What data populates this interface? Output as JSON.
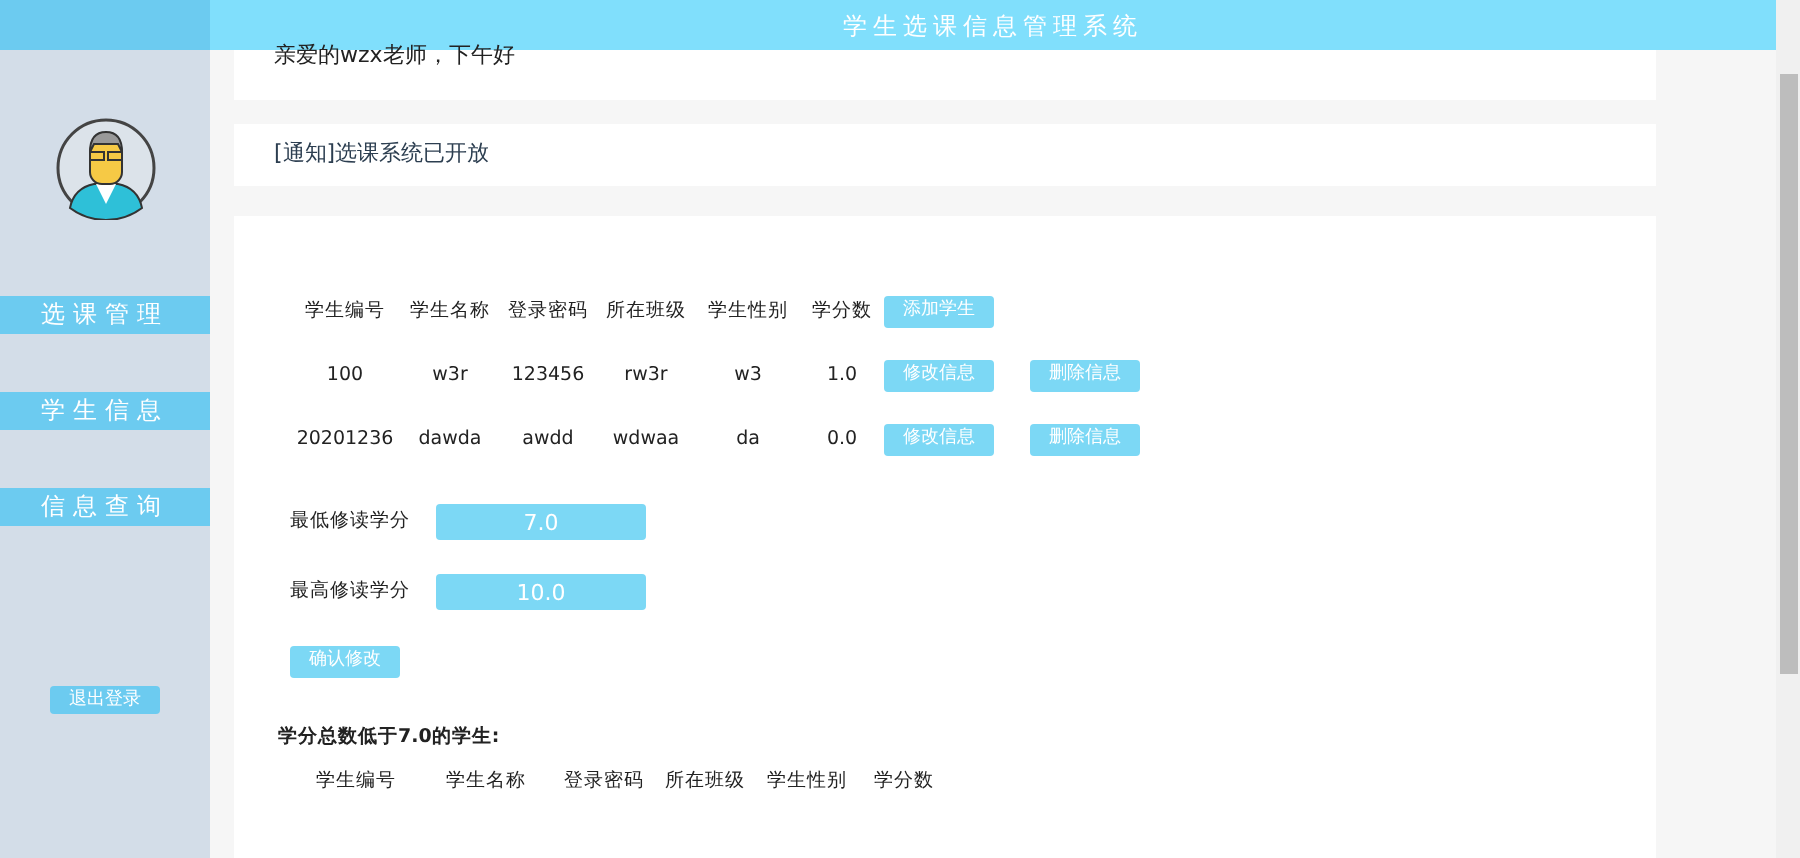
{
  "header": {
    "title": "学生选课信息管理系统"
  },
  "sidebar": {
    "items": [
      {
        "label": "选课管理"
      },
      {
        "label": "学生信息"
      },
      {
        "label": "信息查询"
      }
    ],
    "logout": "退出登录"
  },
  "greeting": "亲爱的wzx老师，下午好",
  "notice": "[通知]选课系统已开放",
  "students": {
    "columns": [
      "学生编号",
      "学生名称",
      "登录密码",
      "所在班级",
      "学生性别",
      "学分数"
    ],
    "add_button": "添加学生",
    "rows": [
      {
        "cells": [
          "100",
          "w3r",
          "123456",
          "rw3r",
          "w3",
          "1.0"
        ],
        "edit": "修改信息",
        "delete": "删除信息"
      },
      {
        "cells": [
          "20201236",
          "dawda",
          "awdd",
          "wdwaa",
          "da",
          "0.0"
        ],
        "edit": "修改信息",
        "delete": "删除信息"
      }
    ]
  },
  "credit_settings": [
    {
      "label": "最低修读学分",
      "value": "7.0"
    },
    {
      "label": "最高修读学分",
      "value": "10.0"
    }
  ],
  "confirm_button": "确认修改",
  "low_credit": {
    "title": "学分总数低于7.0的学生:",
    "columns": [
      "学生编号",
      "学生名称",
      "登录密码",
      "所在班级",
      "学生性别",
      "学分数"
    ]
  }
}
